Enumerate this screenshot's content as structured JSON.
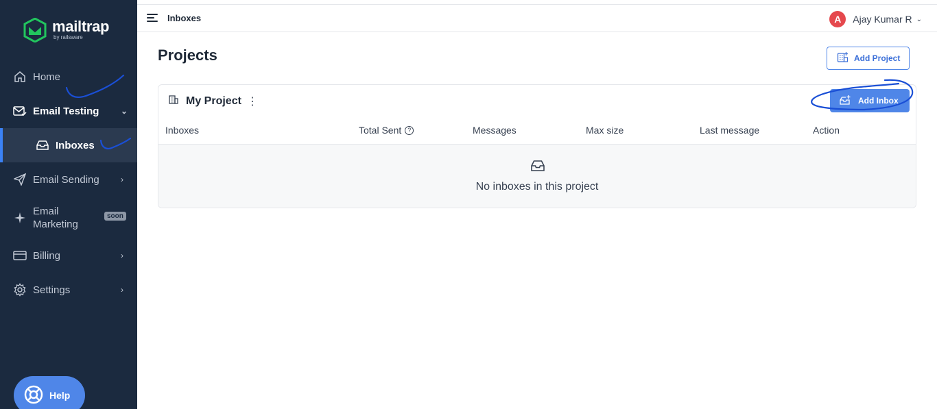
{
  "brand": {
    "name": "mailtrap",
    "sub": "by railsware"
  },
  "sidebar": {
    "items": [
      {
        "label": "Home",
        "icon": "home-icon"
      },
      {
        "label": "Email Testing",
        "icon": "mail-check-icon"
      },
      {
        "label": "Inboxes",
        "icon": "inbox-icon"
      },
      {
        "label": "Email Sending",
        "icon": "send-icon"
      },
      {
        "label": "Email",
        "label2": "Marketing",
        "icon": "sparkle-icon",
        "badge": "soon"
      },
      {
        "label": "Billing",
        "icon": "card-icon"
      },
      {
        "label": "Settings",
        "icon": "gear-icon"
      }
    ],
    "help": "Help"
  },
  "topbar": {
    "title": "Inboxes",
    "user_initial": "A",
    "user_name": "Ajay Kumar R"
  },
  "main": {
    "title": "Projects",
    "add_project": "Add Project",
    "project": {
      "name": "My Project",
      "add_inbox": "Add Inbox",
      "columns": [
        "Inboxes",
        "Total Sent",
        "Messages",
        "Max size",
        "Last message",
        "Action"
      ],
      "empty_text": "No inboxes in this project"
    }
  },
  "colors": {
    "sidebar": "#1b2a3f",
    "accent": "#4f86e8",
    "annotation": "#1a4fd6"
  }
}
